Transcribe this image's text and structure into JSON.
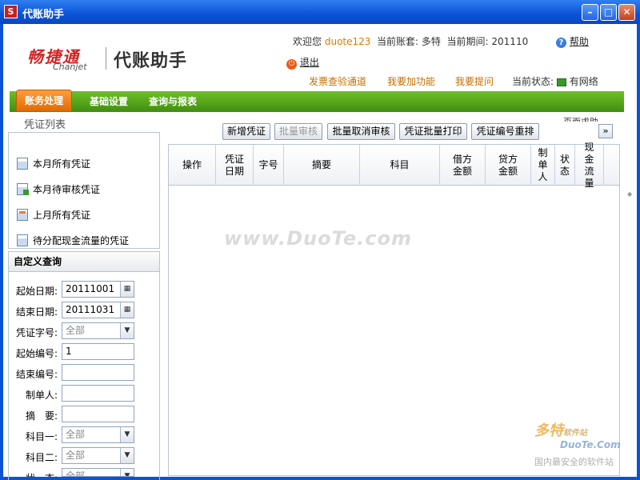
{
  "window": {
    "title": "代账助手",
    "app_icon_letter": "S"
  },
  "header": {
    "brand_cn": "畅捷通",
    "brand_en": "Chanjet",
    "product": "代账助手",
    "welcome_prefix": "欢迎您",
    "username": "duote123",
    "account_label": "当前账套: 多特",
    "period_label": "当前期间: 201110",
    "help": "帮助",
    "logout": "退出",
    "links": [
      "发票查验通道",
      "我要加功能",
      "我要提问"
    ],
    "status_label": "当前状态:",
    "status_value": "有网络"
  },
  "nav": {
    "tabs": [
      "账务处理",
      "基础设置",
      "查询与报表"
    ],
    "active": 0
  },
  "page": {
    "title": "凭证列表",
    "corner_link": "页面求助"
  },
  "left": {
    "quick_items": [
      "本月所有凭证",
      "本月待审核凭证",
      "上月所有凭证",
      "待分配现金流量的凭证"
    ],
    "custom_query_title": "自定义查询",
    "fields": {
      "start_date": {
        "label": "起始日期:",
        "value": "20111001"
      },
      "end_date": {
        "label": "结束日期:",
        "value": "20111031"
      },
      "voucher_type": {
        "label": "凭证字号:",
        "value": "全部"
      },
      "start_no": {
        "label": "起始编号:",
        "value": "1"
      },
      "end_no": {
        "label": "结束编号:",
        "value": ""
      },
      "maker": {
        "label": "制单人:",
        "value": ""
      },
      "summary": {
        "label": "摘　要:",
        "value": ""
      },
      "subject1": {
        "label": "科目一:",
        "value": "全部"
      },
      "subject2": {
        "label": "科目二:",
        "value": "全部"
      },
      "state": {
        "label": "状　态:",
        "value": "全部"
      }
    }
  },
  "toolbar": {
    "new_voucher": "新增凭证",
    "batch_approve": "批量审核",
    "batch_unapprove": "批量取消审核",
    "batch_print": "凭证批量打印",
    "renumber": "凭证编号重排",
    "expand": "»"
  },
  "table": {
    "columns": [
      "操作",
      "凭证日期",
      "字号",
      "摘要",
      "科目",
      "借方金额",
      "贷方金额",
      "制单人",
      "状态",
      "现金流量"
    ]
  },
  "watermarks": {
    "center": "www.DuoTe.com",
    "corner_cn": "多特",
    "corner_sub": "软件站",
    "corner_en": "DuoTe.Com",
    "corner_slogan": "国内最安全的软件站"
  }
}
